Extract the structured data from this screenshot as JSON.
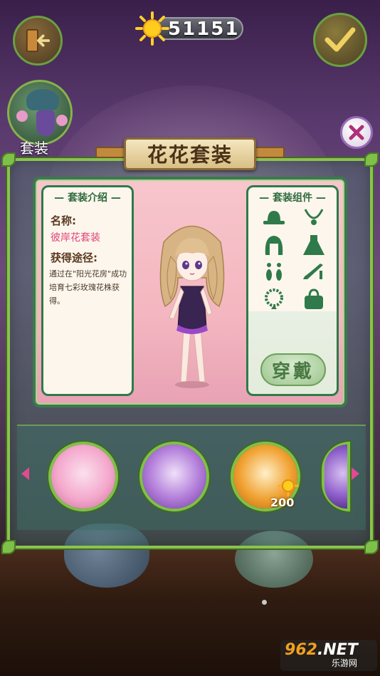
{
  "top_bar": {
    "sun_count": "51151",
    "back_icon": "exit-door-icon",
    "confirm_icon": "checkmark-icon"
  },
  "side_tab": {
    "label": "套装"
  },
  "panel": {
    "title": "花花套装",
    "close_icon": "close-x-icon"
  },
  "info_card": {
    "header": "套装介绍",
    "name_label": "名称:",
    "name_value": "彼岸花套装",
    "source_label": "获得途径:",
    "source_text": "通过在\"阳光花房\"成功培育七彩玫瑰花株获得。"
  },
  "components_card": {
    "header": "套装组件",
    "icons": [
      "hat-icon",
      "necklace-icon",
      "hair-icon",
      "dress-icon",
      "earrings-icon",
      "high-heel-icon",
      "bracelet-icon",
      "handbag-icon"
    ],
    "wear_label": "穿戴"
  },
  "carousel": {
    "items": [
      {
        "name": "pink-flower-outfit",
        "color": "#f4a8cc"
      },
      {
        "name": "purple-flower-outfit",
        "color": "#b07ad8"
      },
      {
        "name": "orange-flower-outfit",
        "color": "#f0a030"
      },
      {
        "name": "violet-outfit-partial",
        "color": "#8a5ac8"
      }
    ],
    "price": "200"
  },
  "watermark": {
    "brand_a": "9",
    "brand_b": "6",
    "brand_c": "2",
    "brand_d": ".NET",
    "sub": "乐游网"
  },
  "colors": {
    "accent_green": "#8cc24e",
    "panel_pink": "#f7c6cc",
    "name_pink": "#e0427a",
    "dark_green": "#2f7a4a"
  }
}
